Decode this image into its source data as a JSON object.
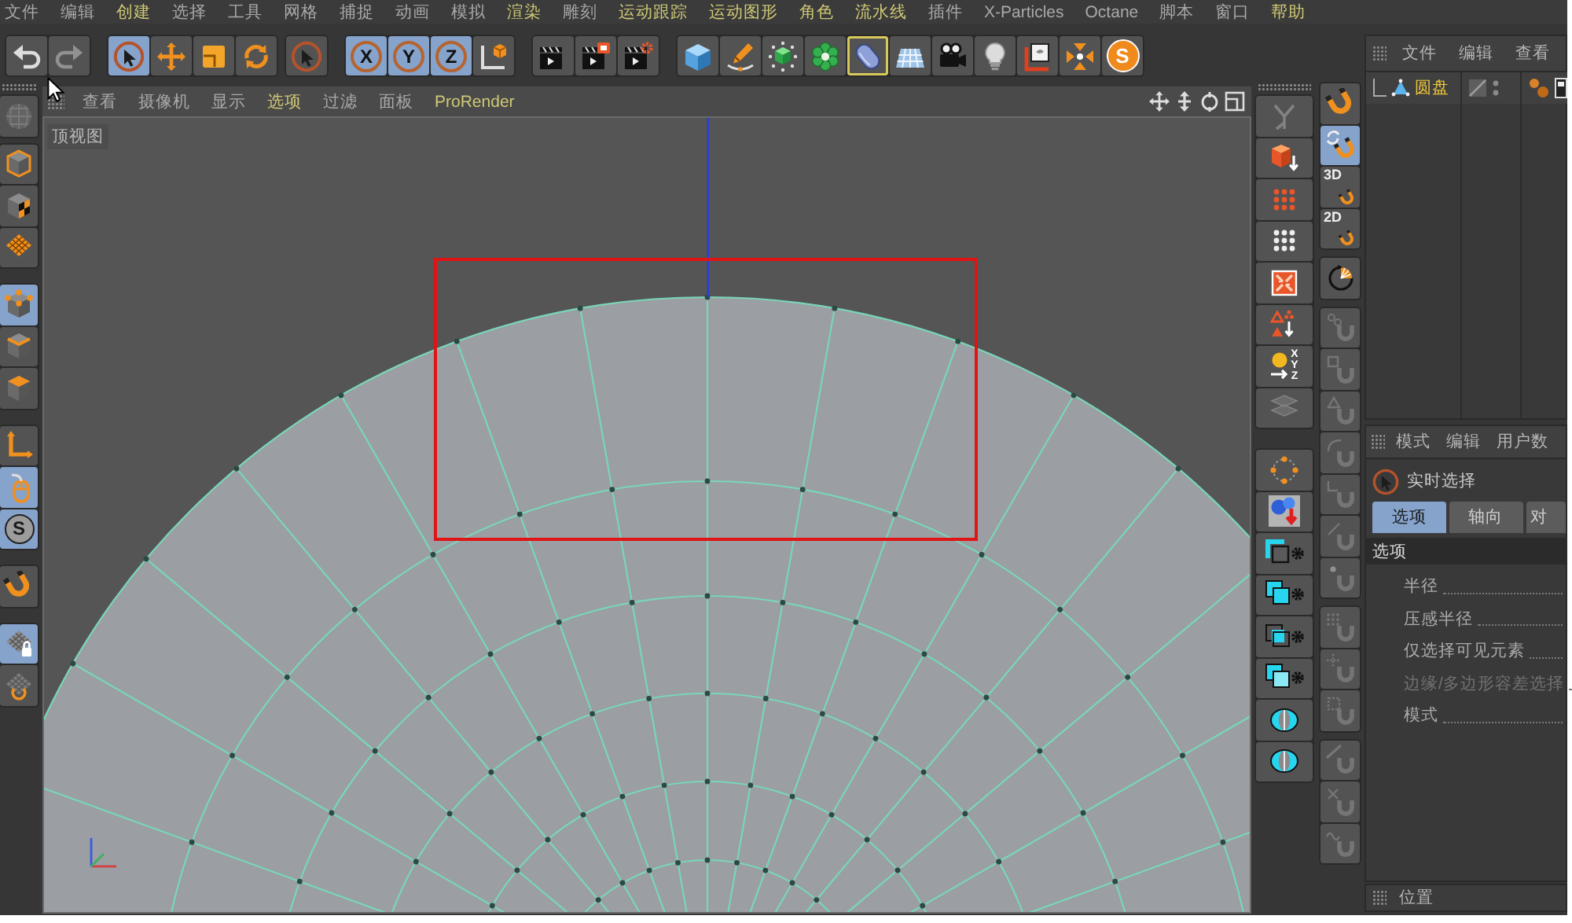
{
  "menu_bar": [
    {
      "label": "文件",
      "highlighted": false
    },
    {
      "label": "编辑",
      "highlighted": false
    },
    {
      "label": "创建",
      "highlighted": true
    },
    {
      "label": "选择",
      "highlighted": false
    },
    {
      "label": "工具",
      "highlighted": false
    },
    {
      "label": "网格",
      "highlighted": false
    },
    {
      "label": "捕捉",
      "highlighted": false
    },
    {
      "label": "动画",
      "highlighted": false
    },
    {
      "label": "模拟",
      "highlighted": false
    },
    {
      "label": "渲染",
      "highlighted": true
    },
    {
      "label": "雕刻",
      "highlighted": false
    },
    {
      "label": "运动跟踪",
      "highlighted": true
    },
    {
      "label": "运动图形",
      "highlighted": true
    },
    {
      "label": "角色",
      "highlighted": true
    },
    {
      "label": "流水线",
      "highlighted": true
    },
    {
      "label": "插件",
      "highlighted": false
    },
    {
      "label": "X-Particles",
      "highlighted": false
    },
    {
      "label": "Octane",
      "highlighted": false
    },
    {
      "label": "脚本",
      "highlighted": false
    },
    {
      "label": "窗口",
      "highlighted": false
    },
    {
      "label": "帮助",
      "highlighted": true
    }
  ],
  "toolbar": [
    [
      {
        "kind": "undo",
        "selected": false,
        "disabled": false
      },
      {
        "kind": "redo",
        "selected": false,
        "disabled": true
      }
    ],
    [
      {
        "kind": "select",
        "selected": true
      },
      {
        "kind": "move",
        "selected": false
      },
      {
        "kind": "scale",
        "selected": false
      },
      {
        "kind": "rotate",
        "selected": false
      }
    ],
    [
      {
        "kind": "select",
        "selected": false
      }
    ],
    [
      {
        "kind": "axis",
        "label": "X",
        "selected": true
      },
      {
        "kind": "axis",
        "label": "Y",
        "selected": true
      },
      {
        "kind": "axis",
        "label": "Z",
        "selected": true
      },
      {
        "kind": "coord-system",
        "selected": false
      }
    ],
    [
      {
        "kind": "render-view",
        "selected": false
      },
      {
        "kind": "render-picture",
        "selected": false
      },
      {
        "kind": "render-settings",
        "selected": false
      }
    ],
    [
      {
        "kind": "cube",
        "selected": false,
        "hovered": false
      },
      {
        "kind": "pen",
        "selected": false,
        "hovered": false
      },
      {
        "kind": "subdivision",
        "selected": false,
        "hovered": false
      },
      {
        "kind": "cloner",
        "selected": false,
        "hovered": false
      },
      {
        "kind": "deformer",
        "selected": false,
        "hovered": true
      },
      {
        "kind": "floor",
        "selected": false,
        "hovered": false
      },
      {
        "kind": "camera",
        "selected": false,
        "hovered": false
      },
      {
        "kind": "light",
        "selected": false,
        "hovered": false
      },
      {
        "kind": "scene",
        "selected": false,
        "hovered": false
      },
      {
        "kind": "effector",
        "selected": false,
        "hovered": false
      },
      {
        "kind": "logo",
        "label": "S",
        "selected": false,
        "hovered": false
      }
    ]
  ],
  "left_toolbar": [
    [
      {
        "kind": "sculpt",
        "selected": false,
        "disabled": true
      }
    ],
    [
      {
        "kind": "model",
        "selected": false
      },
      {
        "kind": "texture",
        "selected": false
      },
      {
        "kind": "workplane",
        "selected": false
      }
    ],
    [
      {
        "kind": "points",
        "selected": true
      },
      {
        "kind": "edges",
        "selected": false
      },
      {
        "kind": "polygons",
        "selected": false
      }
    ],
    [
      {
        "kind": "axis-mode",
        "selected": false
      },
      {
        "kind": "tweak",
        "selected": true
      },
      {
        "kind": "solo",
        "label": "S",
        "selected": true
      }
    ],
    [
      {
        "kind": "magnet",
        "selected": false
      }
    ],
    [
      {
        "kind": "grid-lock",
        "selected": true
      },
      {
        "kind": "grid-rotate",
        "selected": false
      }
    ]
  ],
  "right_toolbar_1": [
    [
      {
        "kind": "bones",
        "disabled": true
      },
      {
        "kind": "cube-drop",
        "disabled": false
      },
      {
        "kind": "dots-orange",
        "disabled": false
      },
      {
        "kind": "dots-white",
        "disabled": false
      },
      {
        "kind": "face-arrows",
        "disabled": false
      },
      {
        "kind": "triangles",
        "disabled": false
      },
      {
        "kind": "xyz-align",
        "label": "X Y Z",
        "disabled": false
      },
      {
        "kind": "planes",
        "disabled": true
      }
    ],
    [
      {
        "kind": "points-frame"
      },
      {
        "kind": "spheres-drop"
      },
      {
        "kind": "squares-gear-a"
      },
      {
        "kind": "squares-gear-b"
      },
      {
        "kind": "squares-gear-c"
      },
      {
        "kind": "squares-gear-d"
      },
      {
        "kind": "ring"
      },
      {
        "kind": "ring"
      }
    ]
  ],
  "right_toolbar_2": [
    [
      {
        "kind": "magnet",
        "selected": false
      },
      {
        "kind": "magnet-cycle",
        "selected": true
      },
      {
        "kind": "magnet-labeled",
        "label": "3D",
        "selected": false
      },
      {
        "kind": "magnet-labeled",
        "label": "2D",
        "selected": false
      }
    ],
    [
      {
        "kind": "dial"
      }
    ],
    [
      {
        "kind": "magnet-dots",
        "disabled": true
      },
      {
        "kind": "magnet-square",
        "disabled": true
      },
      {
        "kind": "magnet-triangle",
        "disabled": true
      },
      {
        "kind": "magnet-arc",
        "disabled": true
      },
      {
        "kind": "magnet-corner",
        "disabled": true
      },
      {
        "kind": "magnet-slash",
        "disabled": true
      },
      {
        "kind": "magnet-dot",
        "disabled": true
      }
    ],
    [
      {
        "kind": "magnet-grid",
        "disabled": true
      },
      {
        "kind": "magnet-plus",
        "disabled": true
      },
      {
        "kind": "magnet-frame",
        "disabled": true
      }
    ],
    [
      {
        "kind": "magnet-line",
        "disabled": true
      },
      {
        "kind": "magnet-cross",
        "disabled": true
      },
      {
        "kind": "magnet-wave",
        "disabled": true
      }
    ]
  ],
  "viewport": {
    "menu": [
      {
        "label": "查看",
        "highlighted": false
      },
      {
        "label": "摄像机",
        "highlighted": false
      },
      {
        "label": "显示",
        "highlighted": false
      },
      {
        "label": "选项",
        "highlighted": true
      },
      {
        "label": "过滤",
        "highlighted": false
      },
      {
        "label": "面板",
        "highlighted": false
      },
      {
        "label": "ProRender",
        "highlighted": true
      }
    ],
    "view_name": "顶视图"
  },
  "object_manager": {
    "menu": [
      "文件",
      "编辑",
      "查看"
    ],
    "objects": [
      {
        "name": "圆盘",
        "selected": true
      }
    ]
  },
  "attribute_manager": {
    "menu": [
      "模式",
      "编辑",
      "用户数"
    ],
    "tool": "实时选择",
    "tabs": [
      {
        "label": "选项",
        "selected": true
      },
      {
        "label": "轴向",
        "selected": false
      },
      {
        "label": "对",
        "selected": false
      }
    ],
    "section": "选项",
    "properties": [
      {
        "label": "半径",
        "disabled": false
      },
      {
        "label": "压感半径",
        "disabled": false
      },
      {
        "label": "仅选择可见元素",
        "disabled": false
      },
      {
        "label": "边缘/多边形容差选择",
        "disabled": true
      },
      {
        "label": "模式",
        "disabled": false
      }
    ]
  },
  "bottom_panel": {
    "title": "位置"
  }
}
